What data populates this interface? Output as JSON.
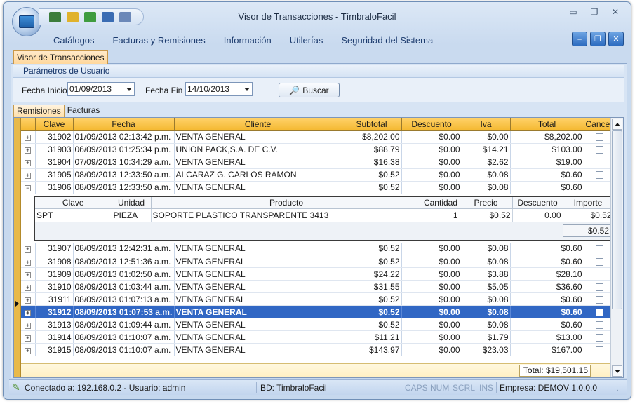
{
  "window": {
    "title": "Visor de Transacciones - TímbraloFacil",
    "controls": [
      "minimize-icon",
      "restore-icon",
      "close-icon"
    ]
  },
  "menu": [
    "Catálogos",
    "Facturas y Remisiones",
    "Información",
    "Utilerías",
    "Seguridad del Sistema"
  ],
  "doc_tab": "Visor de Transacciones",
  "params": {
    "header": "Parámetros de Usuario",
    "fecha_inicio_label": "Fecha Inicio",
    "fecha_inicio": "01/09/2013",
    "fecha_fin_label": "Fecha Fin",
    "fecha_fin": "14/10/2013",
    "buscar": "Buscar"
  },
  "tabs": [
    "Remisiones",
    "Facturas"
  ],
  "grid": {
    "columns": [
      "Clave",
      "Fecha",
      "Cliente",
      "Subtotal",
      "Descuento",
      "Iva",
      "Total",
      "Cancela"
    ],
    "rows_before": [
      [
        "31902",
        "01/09/2013 02:13:42 p.m.",
        "VENTA GENERAL",
        "$8,202.00",
        "$0.00",
        "$0.00",
        "$8,202.00"
      ],
      [
        "31903",
        "06/09/2013 01:25:34 p.m.",
        "UNION PACK,S.A. DE C.V.",
        "$88.79",
        "$0.00",
        "$14.21",
        "$103.00"
      ],
      [
        "31904",
        "07/09/2013 10:34:29 a.m.",
        "VENTA GENERAL",
        "$16.38",
        "$0.00",
        "$2.62",
        "$19.00"
      ],
      [
        "31905",
        "08/09/2013 12:33:50 a.m.",
        "ALCARAZ G. CARLOS RAMON",
        "$0.52",
        "$0.00",
        "$0.08",
        "$0.60"
      ],
      [
        "31906",
        "08/09/2013 12:33:50 a.m.",
        "VENTA GENERAL",
        "$0.52",
        "$0.00",
        "$0.08",
        "$0.60"
      ]
    ],
    "detail": {
      "columns": [
        "Clave",
        "Unidad",
        "Producto",
        "Cantidad",
        "Precio",
        "Descuento",
        "Importe"
      ],
      "rows": [
        [
          "SPT",
          "PIEZA",
          "SOPORTE PLASTICO TRANSPARENTE 3413",
          "1",
          "$0.52",
          "0.00",
          "$0.52"
        ]
      ],
      "sum": "$0.52"
    },
    "rows_after": [
      [
        "31907",
        "08/09/2013 12:42:31 a.m.",
        "VENTA GENERAL",
        "$0.52",
        "$0.00",
        "$0.08",
        "$0.60"
      ],
      [
        "31908",
        "08/09/2013 12:51:36 a.m.",
        "VENTA GENERAL",
        "$0.52",
        "$0.00",
        "$0.08",
        "$0.60"
      ],
      [
        "31909",
        "08/09/2013 01:02:50 a.m.",
        "VENTA GENERAL",
        "$24.22",
        "$0.00",
        "$3.88",
        "$28.10"
      ],
      [
        "31910",
        "08/09/2013 01:03:44 a.m.",
        "VENTA GENERAL",
        "$31.55",
        "$0.00",
        "$5.05",
        "$36.60"
      ],
      [
        "31911",
        "08/09/2013 01:07:13 a.m.",
        "VENTA GENERAL",
        "$0.52",
        "$0.00",
        "$0.08",
        "$0.60"
      ],
      [
        "31912",
        "08/09/2013 01:07:53 a.m.",
        "VENTA GENERAL",
        "$0.52",
        "$0.00",
        "$0.08",
        "$0.60"
      ],
      [
        "31913",
        "08/09/2013 01:09:44 a.m.",
        "VENTA GENERAL",
        "$0.52",
        "$0.00",
        "$0.08",
        "$0.60"
      ],
      [
        "31914",
        "08/09/2013 01:10:07 a.m.",
        "VENTA GENERAL",
        "$11.21",
        "$0.00",
        "$1.79",
        "$13.00"
      ],
      [
        "31915",
        "08/09/2013 01:10:07 a.m.",
        "VENTA GENERAL",
        "$143.97",
        "$0.00",
        "$23.03",
        "$167.00"
      ]
    ],
    "selected_clave": "31912",
    "total": "Total: $19,501.15"
  },
  "status": {
    "connection": "Conectado a: 192.168.0.2 - Usuario: admin",
    "db": "BD: TimbraloFacil",
    "caps": "CAPS",
    "num": "NUM",
    "scrl": "SCRL",
    "ins": "INS",
    "empresa": "Empresa: DEMO",
    "version": "V 1.0.0.0"
  },
  "colors": {
    "accent": "#3167c4",
    "header": "#f4b830",
    "menu_text": "#1b3a6d"
  }
}
